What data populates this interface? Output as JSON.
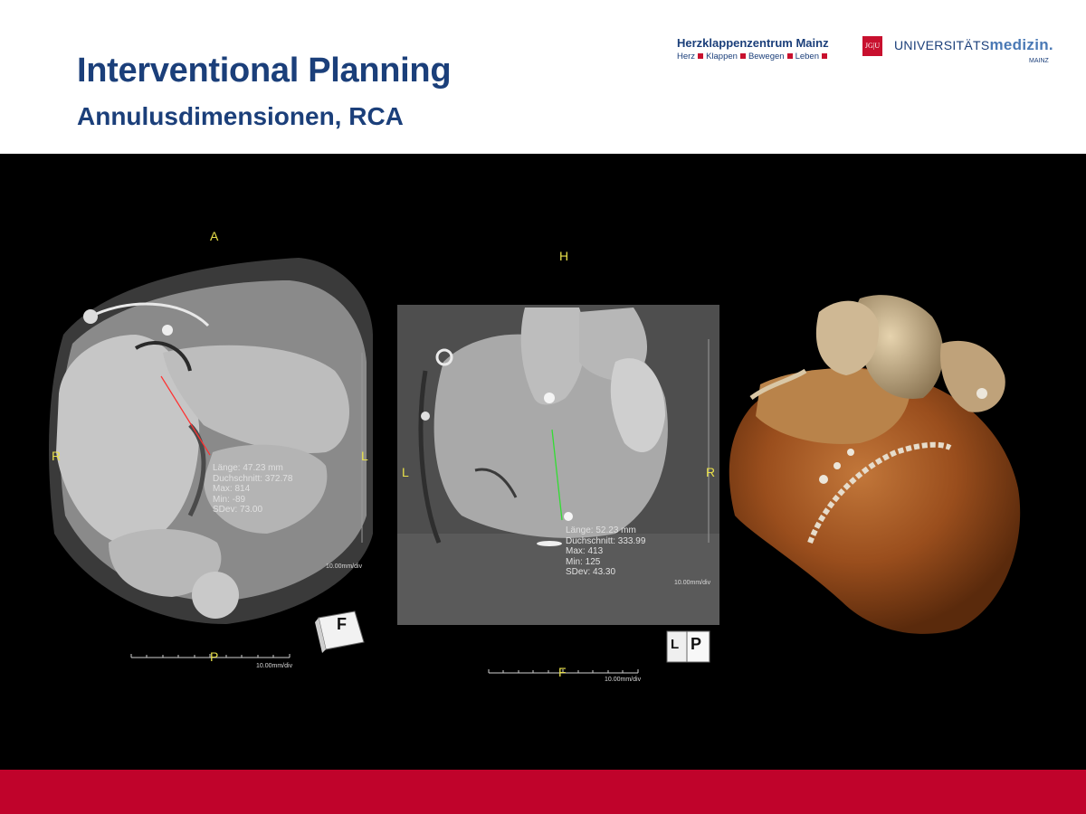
{
  "header": {
    "title": "Interventional Planning",
    "subtitle": "Annulusdimensionen, RCA"
  },
  "logos": {
    "hkz_name": "Herzklappenzentrum Mainz",
    "hkz_tag_1": "Herz",
    "hkz_tag_2": "Klappen",
    "hkz_tag_3": "Bewegen",
    "hkz_tag_4": "Leben",
    "jgu": "JG|U",
    "um_prefix": "UNIVERSITÄTS",
    "um_bold": "medizin.",
    "um_city": "MAINZ"
  },
  "panel1": {
    "orient_top": "A",
    "orient_left": "R",
    "orient_right": "L",
    "orient_bottom": "P",
    "measurement": [
      "Länge: 47.23 mm",
      "Duchschnitt: 372.78",
      "Max: 814",
      "Min: -89",
      "SDev: 73.00"
    ],
    "scale_label": "10.00mm/div",
    "scale_label_bottom": "10.00mm/div",
    "cube_label": "F",
    "accent_color": "#ff3030"
  },
  "panel2": {
    "orient_top": "H",
    "orient_left": "L",
    "orient_right": "R",
    "orient_bottom": "F",
    "measurement": [
      "Länge: 52.23 mm",
      "Duchschnitt: 333.99",
      "Max: 413",
      "Min: 125",
      "SDev: 43.30"
    ],
    "scale_label": "10.00mm/div",
    "scale_label_bottom": "10.00mm/div",
    "cube_label_1": "L",
    "cube_label_2": "P",
    "accent_color": "#33dd33"
  },
  "colors": {
    "title": "#1b3f7a",
    "footer": "#c0032b",
    "overlay_text": "#e9e04a"
  }
}
